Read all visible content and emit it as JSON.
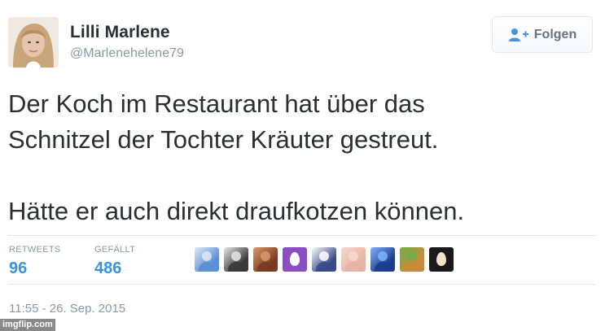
{
  "user": {
    "name": "Lilli Marlene",
    "handle": "@Marlenehelene79"
  },
  "follow_button": {
    "label": "Folgen",
    "icon": "add-user-icon"
  },
  "tweet": {
    "lines_paragraph_1": [
      "Der Koch im Restaurant hat über das",
      "Schnitzel der Tochter Kräuter gestreut."
    ],
    "lines_paragraph_2": [
      "Hätte er auch direkt draufkotzen können."
    ]
  },
  "stats": {
    "retweets_label": "RETWEETS",
    "retweets_value": "96",
    "likes_label": "GEFÄLLT",
    "likes_value": "486"
  },
  "likers": [
    {
      "icon": "blue-figure-avatar",
      "colors": [
        "#5b8fd6",
        "#dfe9f5"
      ]
    },
    {
      "icon": "black-white-portrait-avatar",
      "colors": [
        "#3a3a3a",
        "#e8e8e8"
      ]
    },
    {
      "icon": "man-portrait-avatar",
      "colors": [
        "#7a3b22",
        "#d99a6c"
      ]
    },
    {
      "icon": "purple-egg-avatar",
      "colors": [
        "#8a4fc3",
        "#ffffff"
      ]
    },
    {
      "icon": "pixel-character-avatar",
      "colors": [
        "#3a4a8a",
        "#ffffff"
      ]
    },
    {
      "icon": "skin-closeup-avatar",
      "colors": [
        "#e7b3a3",
        "#f4d9cf"
      ]
    },
    {
      "icon": "blue-negative-avatar",
      "colors": [
        "#1d3c8c",
        "#7fb4ff"
      ]
    },
    {
      "icon": "cartoon-character-avatar",
      "colors": [
        "#c98b3a",
        "#6fae4a"
      ]
    },
    {
      "icon": "egg-on-black-avatar",
      "colors": [
        "#1a1a1a",
        "#f2e2c7"
      ]
    }
  ],
  "timestamp": "11:55 - 26. Sep. 2015",
  "watermark": "imgflip.com"
}
